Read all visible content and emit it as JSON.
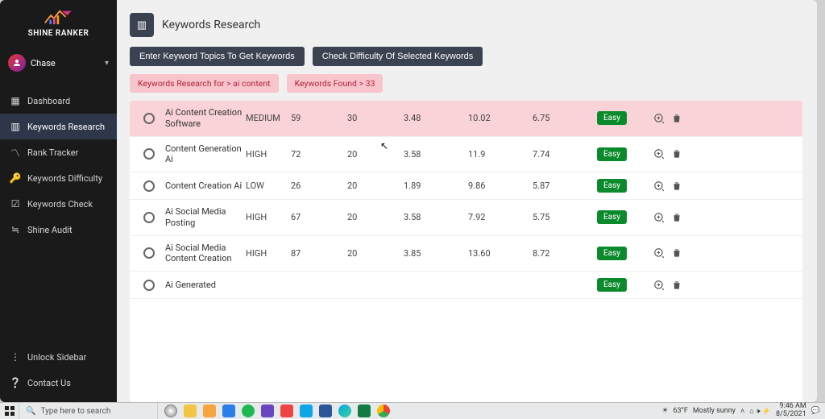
{
  "brand": "SHINE RANKER",
  "user": {
    "name": "Chase"
  },
  "nav": [
    {
      "label": "Dashboard"
    },
    {
      "label": "Keywords Research"
    },
    {
      "label": "Rank Tracker"
    },
    {
      "label": "Keywords Difficulty"
    },
    {
      "label": "Keywords Check"
    },
    {
      "label": "Shine Audit"
    }
  ],
  "bottom_nav": [
    {
      "label": "Unlock Sidebar"
    },
    {
      "label": "Contact Us"
    }
  ],
  "page": {
    "title": "Keywords Research",
    "btn1": "Enter Keyword Topics To Get Keywords",
    "btn2": "Check Difficulty Of Selected Keywords",
    "chip1": "Keywords Research for > ai content",
    "chip2": "Keywords Found > 33"
  },
  "rows": [
    {
      "kw": "Ai Content Creation Software",
      "comp": "MEDIUM",
      "c1": "59",
      "c2": "30",
      "c3": "3.48",
      "c4": "10.02",
      "c5": "6.75",
      "diff": "Easy",
      "selected": true
    },
    {
      "kw": "Content Generation Ai",
      "comp": "HIGH",
      "c1": "72",
      "c2": "20",
      "c3": "3.58",
      "c4": "11.9",
      "c5": "7.74",
      "diff": "Easy",
      "selected": false
    },
    {
      "kw": "Content Creation Ai",
      "comp": "LOW",
      "c1": "26",
      "c2": "20",
      "c3": "1.89",
      "c4": "9.86",
      "c5": "5.87",
      "diff": "Easy",
      "selected": false
    },
    {
      "kw": "Ai Social Media Posting",
      "comp": "HIGH",
      "c1": "67",
      "c2": "20",
      "c3": "3.58",
      "c4": "7.92",
      "c5": "5.75",
      "diff": "Easy",
      "selected": false
    },
    {
      "kw": "Ai Social Media Content Creation",
      "comp": "HIGH",
      "c1": "87",
      "c2": "20",
      "c3": "3.85",
      "c4": "13.60",
      "c5": "8.72",
      "diff": "Easy",
      "selected": false
    },
    {
      "kw": "Ai Generated",
      "comp": "",
      "c1": "",
      "c2": "",
      "c3": "",
      "c4": "",
      "c5": "",
      "diff": "Easy",
      "selected": false
    }
  ],
  "taskbar": {
    "search_placeholder": "Type here to search",
    "weather_temp": "63°F",
    "weather_text": "Mostly sunny",
    "time": "9:46 AM",
    "date": "8/5/2021"
  }
}
